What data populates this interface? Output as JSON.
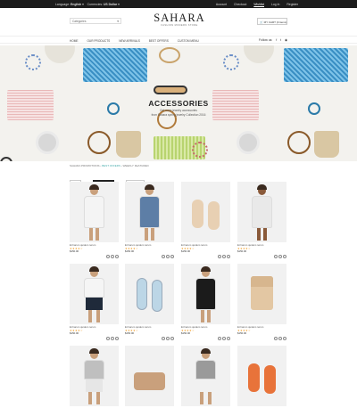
{
  "topbar": {
    "language_label": "Language:",
    "language_value": "English",
    "currencies_label": "Currencies:",
    "currencies_value": "US Dollar",
    "links": [
      "Account",
      "Checkout",
      "Wishlist",
      "Log In",
      "Register"
    ],
    "active_link": "Wishlist"
  },
  "header": {
    "category_select": "Categories",
    "logo_title": "SAHARA",
    "logo_subtitle": "FASHION MODERN STORE",
    "cart": "MY CART (0 items)"
  },
  "nav": {
    "items": [
      "HOME",
      "OUR PRODUCTS",
      "NEW ARRIVALS",
      "BEST OFFERS",
      "CUSTOM MENU"
    ],
    "follow_label": "Follow us:"
  },
  "hero": {
    "heading": "ACCESSORIES",
    "text_line1": "Get more jewelry accessories",
    "text_line2": "from Sahara spring jewelry Collection 2016"
  },
  "breadcrumb": {
    "part1": "SAHARA PROMOTIONS",
    "part2": "BEST OFFERS",
    "part3": "WEEKLY FEATURED"
  },
  "filters": [
    "All",
    "Top Women",
    "Top Men"
  ],
  "products": [
    {
      "name": "Et harum quidem rerum",
      "price": "$150.00",
      "stars": "★★★★☆"
    },
    {
      "name": "Et harum quidem rerum",
      "price": "$150.00",
      "stars": "★★★★☆"
    },
    {
      "name": "Et harum quidem rerum",
      "price": "$150.00",
      "stars": "★★★★☆"
    },
    {
      "name": "Et harum quidem rerum",
      "price": "$150.00",
      "stars": "★★★★☆"
    },
    {
      "name": "Et harum quidem rerum",
      "price": "$150.00",
      "stars": "★★★★☆"
    },
    {
      "name": "Et harum quidem rerum",
      "price": "$150.00",
      "stars": "★★★★☆"
    },
    {
      "name": "Et harum quidem rerum",
      "price": "$150.00",
      "stars": "★★★★☆"
    },
    {
      "name": "Et harum quidem rerum",
      "price": "$150.00",
      "stars": "★★★★☆"
    },
    {
      "name": "",
      "price": "",
      "stars": ""
    },
    {
      "name": "",
      "price": "",
      "stars": ""
    },
    {
      "name": "",
      "price": "",
      "stars": ""
    },
    {
      "name": "",
      "price": "",
      "stars": ""
    }
  ],
  "icons": {
    "social": [
      "facebook-icon",
      "twitter-icon",
      "rss-icon"
    ],
    "card_actions": [
      "wishlist-icon",
      "compare-icon",
      "cart-icon"
    ]
  },
  "colors": {
    "topbar": "#1c1c1c",
    "accent": "#4aa3d6",
    "star": "#f0a030"
  }
}
